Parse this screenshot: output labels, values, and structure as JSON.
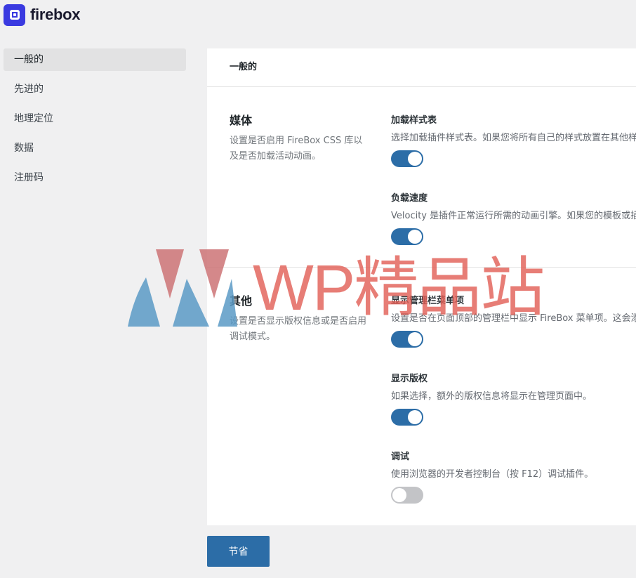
{
  "brand": {
    "name": "firebox"
  },
  "sidebar": {
    "items": [
      {
        "label": "一般的",
        "active": true
      },
      {
        "label": "先进的",
        "active": false
      },
      {
        "label": "地理定位",
        "active": false
      },
      {
        "label": "数据",
        "active": false
      },
      {
        "label": "注册码",
        "active": false
      }
    ]
  },
  "panel": {
    "title": "一般的",
    "sections": [
      {
        "title": "媒体",
        "description": "设置是否启用 FireBox CSS 库以及是否加载活动动画。",
        "fields": [
          {
            "label": "加载样式表",
            "description": "选择加载插件样式表。如果您将所有自己的样式放置在其他样式",
            "enabled": true
          },
          {
            "label": "负载速度",
            "description": "Velocity 是插件正常运行所需的动画引擎。如果您的模板或插件",
            "enabled": true
          }
        ]
      },
      {
        "title": "其他",
        "description": "设置是否显示版权信息或是否启用调试模式。",
        "fields": [
          {
            "label": "显示管理栏菜单项",
            "description": "设置是否在页面顶部的管理栏中显示 FireBox 菜单项。这会添加",
            "enabled": true
          },
          {
            "label": "显示版权",
            "description": "如果选择，额外的版权信息将显示在管理页面中。",
            "enabled": true
          },
          {
            "label": "调试",
            "description": "使用浏览器的开发者控制台（按 F12）调试插件。",
            "enabled": false
          }
        ]
      }
    ]
  },
  "actions": {
    "save_label": "节省"
  },
  "watermark": {
    "text": "WP精品站"
  },
  "colors": {
    "accent": "#2c6da7",
    "logo": "#3a3ae0",
    "watermark_red": "#e26058",
    "watermark_blue": "#5b9ac6"
  }
}
